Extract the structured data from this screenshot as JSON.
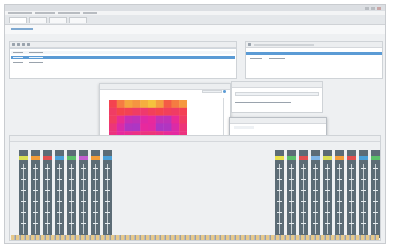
{
  "colors": {
    "accent": "#5b9bd5",
    "strip_bands": [
      "#d9df55",
      "#f29d3a",
      "#e04f4f",
      "#4aa0d8",
      "#5bbf6a",
      "#c35fd2",
      "#f29d3a",
      "#4aa0d8",
      "#e9e04b",
      "#5bbf6a",
      "#e04f4f",
      "#7fb5e6"
    ]
  },
  "window": {
    "title": ""
  },
  "menus": [],
  "tabs": [],
  "path": "",
  "left_table": {
    "headers": [],
    "rows": []
  },
  "right_table": {
    "headers": [],
    "rows": []
  },
  "heatmap": {
    "title": "",
    "grid": [
      [
        0.62,
        0.78,
        0.88,
        0.84,
        0.9,
        0.95,
        0.86,
        0.7,
        0.78,
        0.85
      ],
      [
        0.55,
        0.63,
        0.6,
        0.55,
        0.52,
        0.58,
        0.62,
        0.58,
        0.55,
        0.6
      ],
      [
        0.56,
        0.4,
        0.22,
        0.18,
        0.32,
        0.36,
        0.2,
        0.18,
        0.38,
        0.55
      ],
      [
        0.48,
        0.3,
        0.12,
        0.1,
        0.36,
        0.34,
        0.1,
        0.12,
        0.3,
        0.48
      ],
      [
        0.46,
        0.36,
        0.4,
        0.44,
        0.46,
        0.48,
        0.44,
        0.38,
        0.34,
        0.46
      ],
      [
        0.4,
        0.38,
        0.42,
        0.46,
        0.44,
        0.48,
        0.42,
        0.4,
        0.36,
        0.42
      ],
      [
        0.44,
        0.34,
        0.18,
        0.14,
        0.4,
        0.36,
        0.14,
        0.18,
        0.32,
        0.44
      ],
      [
        0.46,
        0.32,
        0.14,
        0.1,
        0.32,
        0.34,
        0.12,
        0.16,
        0.3,
        0.46
      ],
      [
        0.5,
        0.42,
        0.32,
        0.36,
        0.42,
        0.44,
        0.34,
        0.32,
        0.4,
        0.48
      ],
      [
        0.38,
        0.32,
        0.3,
        0.34,
        0.36,
        0.34,
        0.3,
        0.28,
        0.3,
        0.38
      ]
    ]
  },
  "dialog": {
    "title": "",
    "swatches": [
      "#f2c94c",
      "#d9d9d9",
      "#f2994a",
      "#eb5757",
      "#2f80ed",
      "#27ae60",
      "#4aa0d8"
    ],
    "sliders": [
      0.55,
      0.45,
      0.7,
      0.5,
      0.62,
      0.4,
      0.58
    ]
  }
}
